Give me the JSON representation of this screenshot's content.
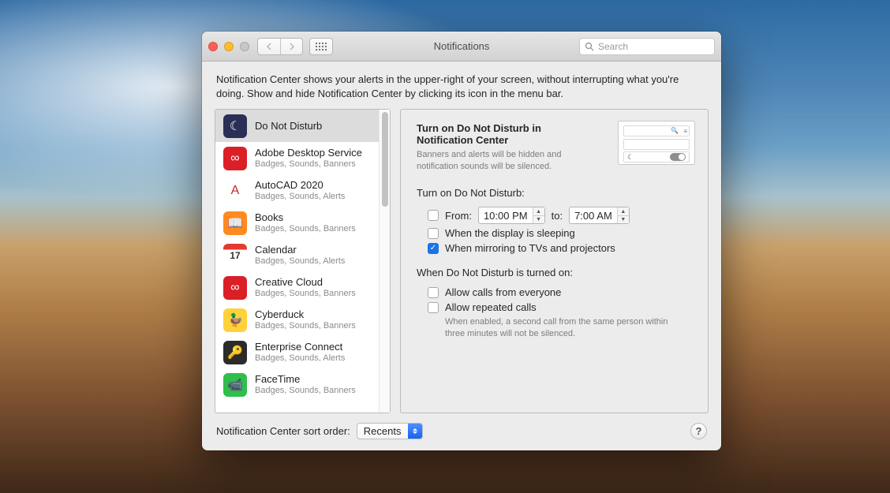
{
  "window": {
    "title": "Notifications",
    "search_placeholder": "Search"
  },
  "intro": "Notification Center shows your alerts in the upper-right of your screen, without interrupting what you're doing. Show and hide Notification Center by clicking its icon in the menu bar.",
  "sidebar": {
    "items": [
      {
        "name": "Do Not Disturb",
        "sub": "",
        "icon_bg": "#2b2f57",
        "icon_txt": "☾",
        "selected": true
      },
      {
        "name": "Adobe Desktop Service",
        "sub": "Badges, Sounds, Banners",
        "icon_bg": "#da1f26",
        "icon_txt": "∞"
      },
      {
        "name": "AutoCAD 2020",
        "sub": "Badges, Sounds, Alerts",
        "icon_bg": "#ffffff",
        "icon_txt": "A",
        "icon_fg": "#c02828"
      },
      {
        "name": "Books",
        "sub": "Badges, Sounds, Banners",
        "icon_bg": "#ff8a1f",
        "icon_txt": "📖"
      },
      {
        "name": "Calendar",
        "sub": "Badges, Sounds, Alerts",
        "icon_bg": "#ffffff",
        "icon_txt": "17",
        "icon_fg": "#333333",
        "icon_top": "#e33b2e"
      },
      {
        "name": "Creative Cloud",
        "sub": "Badges, Sounds, Banners",
        "icon_bg": "#da1f26",
        "icon_txt": "∞"
      },
      {
        "name": "Cyberduck",
        "sub": "Badges, Sounds, Banners",
        "icon_bg": "#ffd23b",
        "icon_txt": "🦆"
      },
      {
        "name": "Enterprise Connect",
        "sub": "Badges, Sounds, Alerts",
        "icon_bg": "#2b2b2b",
        "icon_txt": "🔑"
      },
      {
        "name": "FaceTime",
        "sub": "Badges, Sounds, Banners",
        "icon_bg": "#2fbf4b",
        "icon_txt": "📹"
      }
    ]
  },
  "detail": {
    "title": "Turn on Do Not Disturb in Notification Center",
    "desc": "Banners and alerts will be hidden and notification sounds will be silenced.",
    "schedule_label": "Turn on Do Not Disturb:",
    "from_label": "From:",
    "from_time": "10:00 PM",
    "to_label": "to:",
    "to_time": "7:00 AM",
    "display_sleep_label": "When the display is sleeping",
    "mirroring_label": "When mirroring to TVs and projectors",
    "section2_label": "When Do Not Disturb is turned on:",
    "allow_everyone_label": "Allow calls from everyone",
    "allow_repeated_label": "Allow repeated calls",
    "repeated_hint": "When enabled, a second call from the same person within three minutes will not be silenced.",
    "checks": {
      "from": false,
      "display_sleep": false,
      "mirroring": true,
      "allow_everyone": false,
      "allow_repeated": false
    }
  },
  "footer": {
    "label": "Notification Center sort order:",
    "value": "Recents"
  }
}
